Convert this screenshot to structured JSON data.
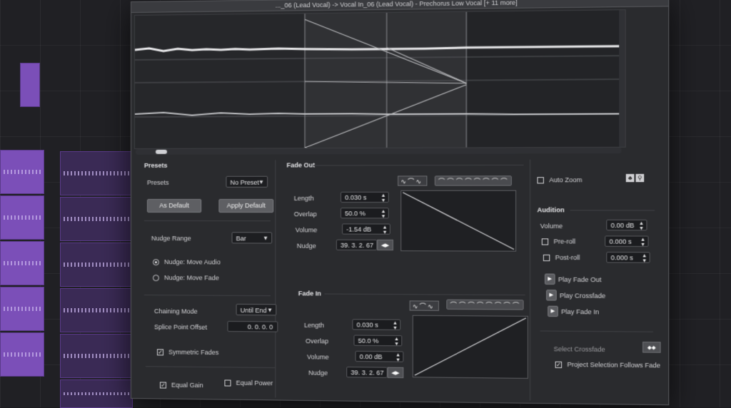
{
  "window": {
    "title": "..._06 (Lead Vocal) -> Vocal In_06 (Lead Vocal) - Prechorus Low Vocal [+ 11 more]"
  },
  "presets": {
    "section_label": "Presets",
    "presets_label": "Presets",
    "presets_value": "No Preset",
    "as_default": "As Default",
    "apply_default": "Apply Default",
    "nudge_range_label": "Nudge Range",
    "nudge_range_value": "Bar",
    "nudge_move_audio": "Nudge: Move Audio",
    "nudge_move_fade": "Nudge: Move Fade",
    "chaining_mode_label": "Chaining Mode",
    "chaining_mode_value": "Until End",
    "splice_point_offset_label": "Splice Point Offset",
    "splice_point_offset_value": "0. 0. 0. 0",
    "symmetric_fades": "Symmetric Fades",
    "equal_gain": "Equal Gain",
    "equal_power": "Equal Power"
  },
  "fade_out": {
    "section_label": "Fade Out",
    "length_label": "Length",
    "length_value": "0.030 s",
    "overlap_label": "Overlap",
    "overlap_value": "50.0 %",
    "volume_label": "Volume",
    "volume_value": "-1.54 dB",
    "nudge_label": "Nudge",
    "nudge_value": "39. 3. 2. 67"
  },
  "fade_in": {
    "section_label": "Fade In",
    "length_label": "Length",
    "length_value": "0.030 s",
    "overlap_label": "Overlap",
    "overlap_value": "50.0 %",
    "volume_label": "Volume",
    "volume_value": "0.00 dB",
    "nudge_label": "Nudge",
    "nudge_value": "39. 3. 2. 67"
  },
  "right_panel": {
    "auto_zoom": "Auto Zoom",
    "audition_label": "Audition",
    "volume_label": "Volume",
    "volume_value": "0.00 dB",
    "preroll_label": "Pre-roll",
    "preroll_value": "0.000 s",
    "postroll_label": "Post-roll",
    "postroll_value": "0.000 s",
    "play_fade_out": "Play Fade Out",
    "play_crossfade": "Play Crossfade",
    "play_fade_in": "Play Fade In",
    "select_crossfade": "Select Crossfade",
    "project_selection_follows_fade": "Project Selection Follows Fade"
  }
}
